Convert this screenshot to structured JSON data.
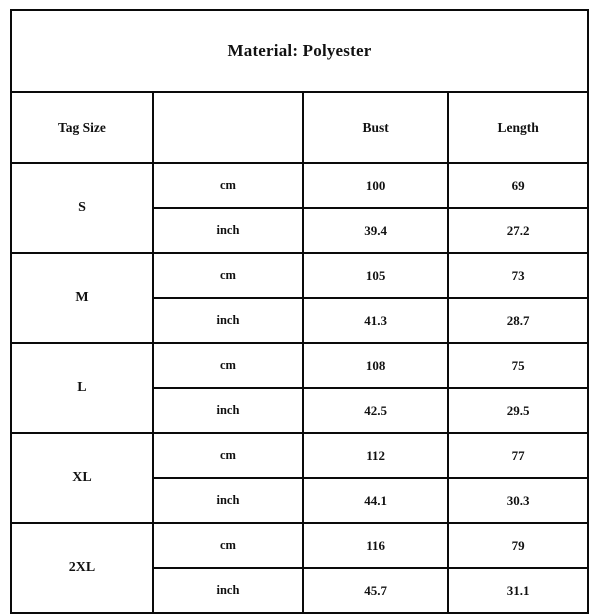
{
  "chart_data": {
    "type": "table",
    "title": "Material: Polyester",
    "columns": [
      "Tag Size",
      "",
      "Bust",
      "Length"
    ],
    "units": [
      "cm",
      "inch"
    ],
    "rows": [
      {
        "size": "S",
        "cm": {
          "unit": "cm",
          "bust": "100",
          "length": "69"
        },
        "inch": {
          "unit": "inch",
          "bust": "39.4",
          "length": "27.2"
        }
      },
      {
        "size": "M",
        "cm": {
          "unit": "cm",
          "bust": "105",
          "length": "73"
        },
        "inch": {
          "unit": "inch",
          "bust": "41.3",
          "length": "28.7"
        }
      },
      {
        "size": "L",
        "cm": {
          "unit": "cm",
          "bust": "108",
          "length": "75"
        },
        "inch": {
          "unit": "inch",
          "bust": "42.5",
          "length": "29.5"
        }
      },
      {
        "size": "XL",
        "cm": {
          "unit": "cm",
          "bust": "112",
          "length": "77"
        },
        "inch": {
          "unit": "inch",
          "bust": "44.1",
          "length": "30.3"
        }
      },
      {
        "size": "2XL",
        "cm": {
          "unit": "cm",
          "bust": "116",
          "length": "79"
        },
        "inch": {
          "unit": "inch",
          "bust": "45.7",
          "length": "31.1"
        }
      }
    ],
    "highlight_color": "#bfbfbf",
    "border_color": "#0a0a0a",
    "background_color": "#ffffff",
    "highlighted_rows": "inch"
  }
}
